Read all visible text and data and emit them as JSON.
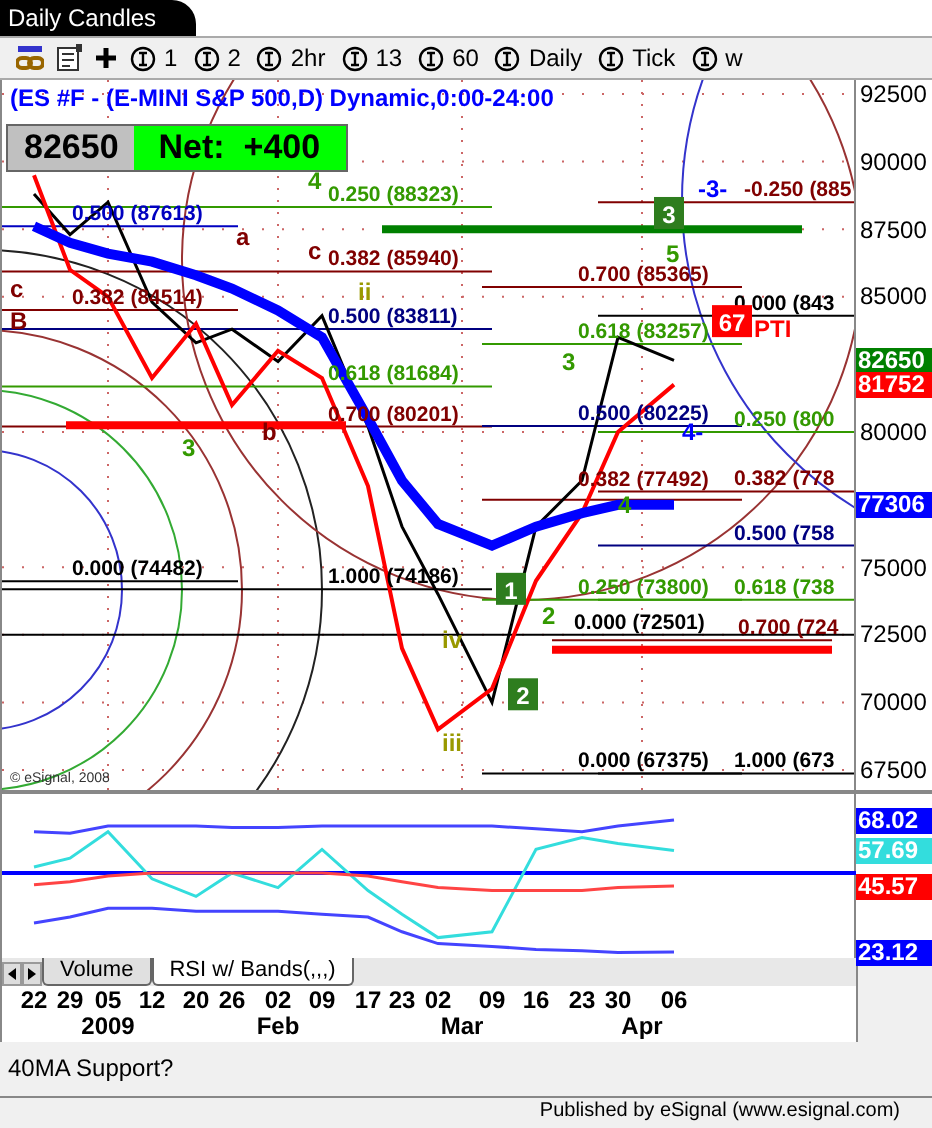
{
  "window": {
    "title": "Daily Candles"
  },
  "toolbar": {
    "intervals": [
      "1",
      "2",
      "2hr",
      "13",
      "60",
      "Daily",
      "Tick",
      "w"
    ]
  },
  "chart": {
    "symbol_title": "(ES #F - (E-MINI S&P 500,D) Dynamic,0:00-24:00",
    "last_price": "82650",
    "net_change": "Net:  +400",
    "copyright": "© eSignal, 2008",
    "price_axis": [
      "92500",
      "90000",
      "87500",
      "85000",
      "80000",
      "75000",
      "72500",
      "70000",
      "67500"
    ],
    "price_tags": [
      {
        "text": "82650",
        "color": "#008000"
      },
      {
        "text": "81752",
        "color": "#ff0000"
      },
      {
        "text": "77306",
        "color": "#0000ff"
      }
    ],
    "levels": [
      {
        "text": "0.250 (88323)",
        "color": "#339900"
      },
      {
        "text": "0.500 (87613)",
        "color": "#0000c0"
      },
      {
        "text": "0.382 (85940)",
        "color": "#800000"
      },
      {
        "text": "0.382 (84514)",
        "color": "#800000"
      },
      {
        "text": "0.500 (83811)",
        "color": "#000080"
      },
      {
        "text": "0.618 (81684)",
        "color": "#339900"
      },
      {
        "text": "0.700 (80201)",
        "color": "#800000"
      },
      {
        "text": "0.000 (74482)",
        "color": "#000000"
      },
      {
        "text": "1.000 (74186)",
        "color": "#000000"
      },
      {
        "text": "-0.250 (885",
        "color": "#800000"
      },
      {
        "text": "0.700 (85365)",
        "color": "#800000"
      },
      {
        "text": "0.000 (843",
        "color": "#000000"
      },
      {
        "text": "0.618 (83257)",
        "color": "#339900"
      },
      {
        "text": "0.500 (80225)",
        "color": "#000080"
      },
      {
        "text": "0.250 (800",
        "color": "#339900"
      },
      {
        "text": "0.382 (778",
        "color": "#800000"
      },
      {
        "text": "0.382 (77492)",
        "color": "#800000"
      },
      {
        "text": "0.500 (758",
        "color": "#000080"
      },
      {
        "text": "0.250 (73800)",
        "color": "#339900"
      },
      {
        "text": "0.618 (738",
        "color": "#339900"
      },
      {
        "text": "0.000 (72501)",
        "color": "#000000"
      },
      {
        "text": "0.700 (724",
        "color": "#800000"
      },
      {
        "text": "0.000 (67375)",
        "color": "#000000"
      },
      {
        "text": "1.000 (673",
        "color": "#000000"
      }
    ],
    "wave_labels": [
      {
        "text": "4",
        "color": "#339900"
      },
      {
        "text": "a",
        "color": "#800000"
      },
      {
        "text": "c",
        "color": "#800000"
      },
      {
        "text": "c",
        "color": "#800000"
      },
      {
        "text": "B",
        "color": "#800000"
      },
      {
        "text": "b",
        "color": "#800000"
      },
      {
        "text": "3",
        "color": "#339900"
      },
      {
        "text": "ii",
        "color": "#999900"
      },
      {
        "text": "3",
        "color": "#339900"
      },
      {
        "text": "5",
        "color": "#339900"
      },
      {
        "text": "-3-",
        "color": "#0000ff"
      },
      {
        "text": "4-",
        "color": "#0000ff"
      },
      {
        "text": "4",
        "color": "#339900"
      },
      {
        "text": "2",
        "color": "#339900"
      },
      {
        "text": "iv",
        "color": "#999900"
      },
      {
        "text": "iii",
        "color": "#999900"
      },
      {
        "text": "PTI",
        "color": "#ff0000"
      }
    ],
    "markers": [
      {
        "text": "1",
        "color": "#2e7d1e"
      },
      {
        "text": "2",
        "color": "#2e7d1e"
      },
      {
        "text": "3",
        "color": "#2e7d1e"
      },
      {
        "text": "67",
        "color": "#ff0000"
      }
    ]
  },
  "rsi_pane": {
    "tags": [
      {
        "text": "68.02",
        "color": "#0000ff"
      },
      {
        "text": "57.69",
        "color": "#33dddd"
      },
      {
        "text": "45.57",
        "color": "#ff0000"
      },
      {
        "text": "23.12",
        "color": "#0000ff"
      }
    ],
    "tabs": [
      {
        "label": "Volume",
        "selected": false
      },
      {
        "label": "RSI w/ Bands(,,,)",
        "selected": true
      }
    ]
  },
  "date_axis": {
    "days": [
      "22",
      "29",
      "05",
      "12",
      "20",
      "26",
      "02",
      "09",
      "17",
      "23",
      "02",
      "09",
      "16",
      "23",
      "30",
      "06"
    ],
    "months": [
      "2009",
      "Feb",
      "Mar",
      "Apr"
    ]
  },
  "note": "40MA Support?",
  "footer": "Published by eSignal (www.esignal.com)"
}
